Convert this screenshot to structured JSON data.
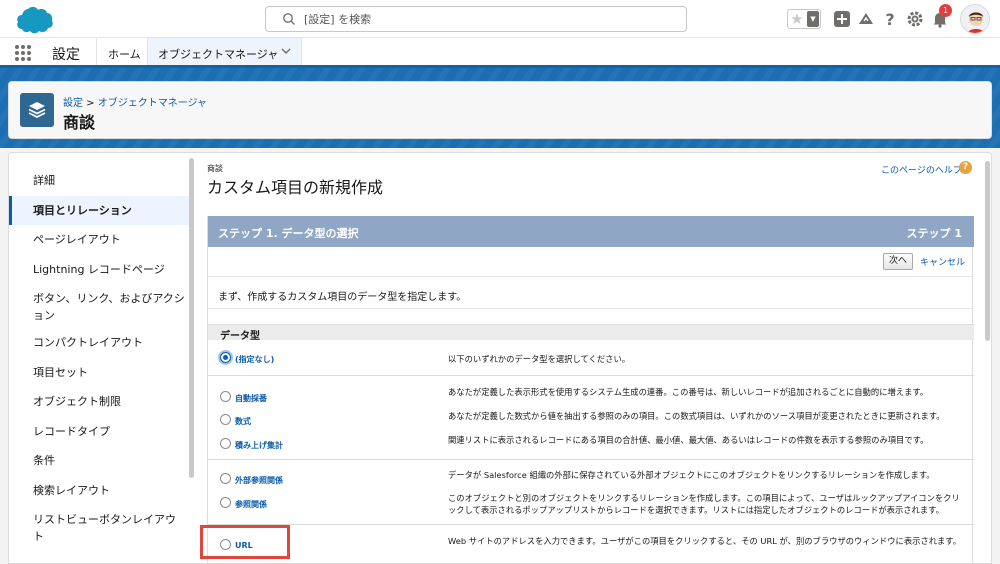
{
  "header": {
    "search_placeholder": "[設定] を検索",
    "notification_count": "1",
    "icons": [
      "favorite-star-icon",
      "add-icon",
      "trailhead-icon",
      "help-icon",
      "setup-gear-icon",
      "bell-icon"
    ]
  },
  "app_nav": {
    "app_name": "設定",
    "home_tab": "ホーム",
    "active_tab": "オブジェクトマネージャ"
  },
  "page_header": {
    "breadcrumb_setup": "設定",
    "breadcrumb_sep": " > ",
    "breadcrumb_obj": "オブジェクトマネージャ",
    "title": "商談"
  },
  "sidebar": {
    "items": [
      {
        "label": "詳細"
      },
      {
        "label": "項目とリレーション"
      },
      {
        "label": "ページレイアウト"
      },
      {
        "label": "Lightning レコードページ"
      },
      {
        "label": "ボタン、リンク、およびアクション"
      },
      {
        "label": "コンパクトレイアウト"
      },
      {
        "label": "項目セット"
      },
      {
        "label": "オブジェクト制限"
      },
      {
        "label": "レコードタイプ"
      },
      {
        "label": "条件"
      },
      {
        "label": "検索レイアウト"
      },
      {
        "label": "リストビューボタンレイアウト"
      }
    ]
  },
  "content": {
    "object_label": "商談",
    "title": "カスタム項目の新規作成",
    "help_link": "このページのヘルプ",
    "step_title": "ステップ 1. データ型の選択",
    "step_right": "ステップ 1",
    "next_button": "次へ",
    "cancel_link": "キャンセル",
    "intro": "まず、作成するカスタム項目のデータ型を指定します。",
    "datatype_header": "データ型",
    "options": [
      {
        "label": "(指定なし)",
        "desc": "以下のいずれかのデータ型を選択してください。"
      },
      {
        "label": "自動採番",
        "desc": "あなたが定義した表示形式を使用するシステム生成の連番。この番号は、新しいレコードが追加されるごとに自動的に増えます。"
      },
      {
        "label": "数式",
        "desc": "あなたが定義した数式から値を抽出する参照のみの項目。この数式項目は、いずれかのソース項目が変更されたときに更新されます。"
      },
      {
        "label": "積み上げ集計",
        "desc": "関連リストに表示されるレコードにある項目の合計値、最小値、最大値、あるいはレコードの件数を表示する参照のみ項目です。"
      },
      {
        "label": "外部参照関係",
        "desc": "データが Salesforce 組織の外部に保存されている外部オブジェクトにこのオブジェクトをリンクするリレーションを作成します。"
      },
      {
        "label": "参照関係",
        "desc": "このオブジェクトと別のオブジェクトをリンクするリレーションを作成します。この項目によって、ユーザはルックアップアイコンをクリックして表示されるポップアップリストからレコードを選択できます。リストには指定したオブジェクトのレコードが表示されます。"
      },
      {
        "label": "URL",
        "desc": "Web サイトのアドレスを入力できます。ユーザがこの項目をクリックすると、その URL が、別のブラウザのウィンドウに表示されます。"
      }
    ]
  },
  "colors": {
    "accent": "#0b5cab",
    "brand_blue": "#1c6eb2",
    "step_bar": "#8fa6c4",
    "highlight": "#e0473a"
  }
}
